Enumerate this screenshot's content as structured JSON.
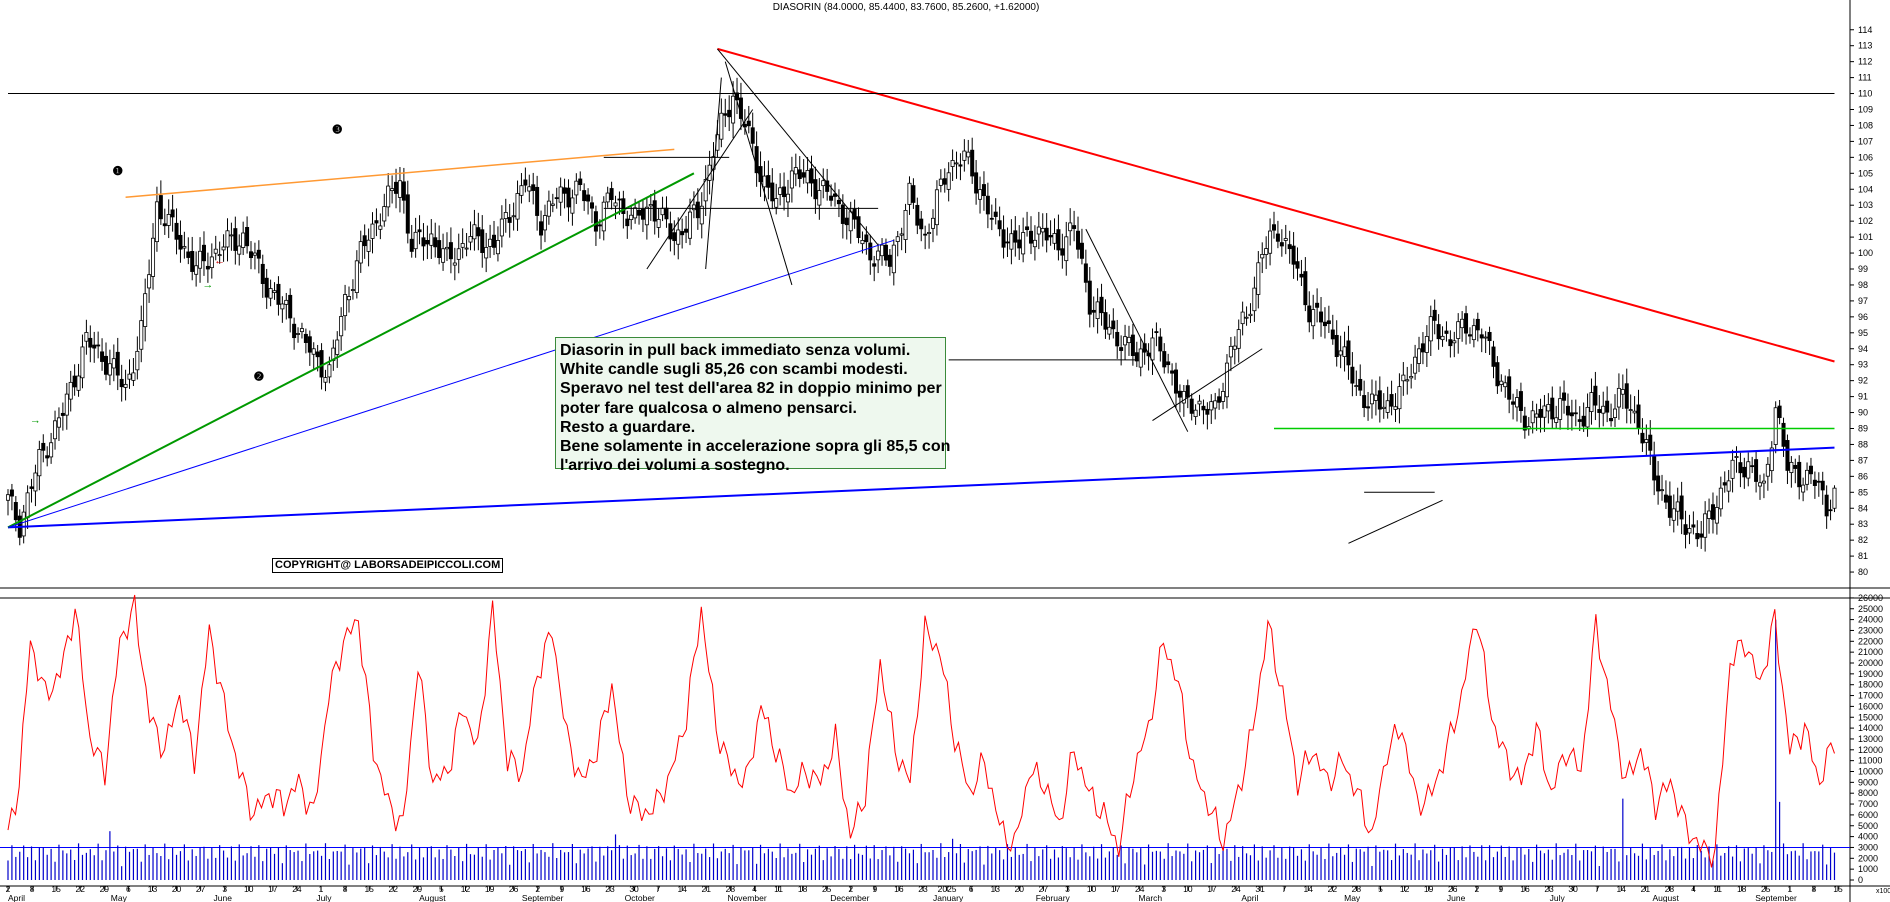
{
  "header": {
    "title": "DIASORIN (84.0000, 85.4400, 83.7600, 85.2600, +1.62000)"
  },
  "annotation": {
    "lines": [
      "Diasorin in pull back immediato senza volumi.",
      "White candle sugli 85,26 con scambi modesti.",
      "Speravo nel test dell'area 82 in doppio minimo per",
      "poter fare qualcosa o almeno pensarci.",
      "Resto a guardare.",
      "Bene solamente in accelerazione sopra gli 85,5 con",
      "l'arrivo dei volumi a sostegno."
    ]
  },
  "copyright": "COPYRIGHT@ LABORSADEIPICCOLI.COM",
  "markers": [
    "❶",
    "❷",
    "❸"
  ],
  "volume_scale_label": "x100",
  "chart_data": [
    {
      "type": "candlestick",
      "title": "DIASORIN (84.0000, 85.4400, 83.7600, 85.2600, +1.62000)",
      "ylim": [
        79,
        115
      ],
      "yticks": [
        80,
        81,
        82,
        83,
        84,
        85,
        86,
        87,
        88,
        89,
        90,
        91,
        92,
        93,
        94,
        95,
        96,
        97,
        98,
        99,
        100,
        101,
        102,
        103,
        104,
        105,
        106,
        107,
        108,
        109,
        110,
        111,
        112,
        113,
        114
      ],
      "x_labels": [
        "2",
        "8",
        "15",
        "22",
        "29",
        "6",
        "13",
        "20",
        "27",
        "3",
        "10",
        "17",
        "24",
        "1",
        "8",
        "15",
        "22",
        "29",
        "5",
        "12",
        "19",
        "26",
        "2",
        "9",
        "16",
        "23",
        "30",
        "7",
        "14",
        "21",
        "28",
        "4",
        "11",
        "18",
        "25",
        "2",
        "9",
        "16",
        "23",
        "2025",
        "6",
        "13",
        "20",
        "27",
        "3",
        "10",
        "17",
        "24",
        "3",
        "10",
        "17",
        "24",
        "31",
        "7",
        "14",
        "22",
        "28",
        "5",
        "12",
        "19",
        "26",
        "2",
        "9",
        "16",
        "23",
        "30",
        "7",
        "14",
        "21",
        "28",
        "4",
        "11",
        "18",
        "25",
        "1",
        "8",
        "15"
      ],
      "month_labels": [
        "April",
        "May",
        "June",
        "July",
        "August",
        "September",
        "October",
        "November",
        "December",
        "January",
        "February",
        "March",
        "April",
        "May",
        "June",
        "July",
        "August",
        "September"
      ],
      "last_candle": {
        "open": 84.0,
        "high": 85.44,
        "low": 83.76,
        "close": 85.26,
        "change": 1.62
      },
      "close_path": [
        [
          0,
          84.5
        ],
        [
          3,
          83.0
        ],
        [
          8,
          87.0
        ],
        [
          14,
          90.0
        ],
        [
          20,
          94.5
        ],
        [
          26,
          93.0
        ],
        [
          30,
          91.5
        ],
        [
          34,
          95.0
        ],
        [
          38,
          103.0
        ],
        [
          42,
          101.5
        ],
        [
          48,
          99.0
        ],
        [
          55,
          100.5
        ],
        [
          60,
          101.0
        ],
        [
          66,
          98.0
        ],
        [
          72,
          96.0
        ],
        [
          78,
          93.5
        ],
        [
          82,
          92.5
        ],
        [
          86,
          97.0
        ],
        [
          90,
          100.0
        ],
        [
          96,
          103.0
        ],
        [
          100,
          104.5
        ],
        [
          103,
          100.5
        ],
        [
          108,
          101.0
        ],
        [
          112,
          99.5
        ],
        [
          118,
          101.0
        ],
        [
          124,
          100.5
        ],
        [
          128,
          102.5
        ],
        [
          132,
          104.5
        ],
        [
          136,
          102.0
        ],
        [
          140,
          103.5
        ],
        [
          146,
          104.0
        ],
        [
          150,
          102.0
        ],
        [
          154,
          103.5
        ],
        [
          160,
          102.0
        ],
        [
          164,
          103.0
        ],
        [
          170,
          101.0
        ],
        [
          176,
          102.5
        ],
        [
          180,
          106.5
        ],
        [
          185,
          110.0
        ],
        [
          188,
          108.0
        ],
        [
          192,
          105.0
        ],
        [
          196,
          103.0
        ],
        [
          200,
          105.0
        ],
        [
          205,
          104.5
        ],
        [
          210,
          103.5
        ],
        [
          215,
          102.0
        ],
        [
          220,
          100.0
        ],
        [
          225,
          99.5
        ],
        [
          230,
          103.5
        ],
        [
          234,
          101.0
        ],
        [
          240,
          105.5
        ],
        [
          244,
          106.0
        ],
        [
          248,
          104.0
        ],
        [
          252,
          101.5
        ],
        [
          258,
          100.5
        ],
        [
          262,
          101.5
        ],
        [
          268,
          100.5
        ],
        [
          272,
          101.5
        ],
        [
          276,
          97.0
        ],
        [
          280,
          95.5
        ],
        [
          284,
          94.5
        ],
        [
          288,
          93.5
        ],
        [
          292,
          94.5
        ],
        [
          296,
          93.0
        ],
        [
          300,
          90.5
        ],
        [
          304,
          90.5
        ],
        [
          308,
          90.0
        ],
        [
          312,
          94.0
        ],
        [
          316,
          96.0
        ],
        [
          320,
          100.0
        ],
        [
          324,
          101.5
        ],
        [
          328,
          99.5
        ],
        [
          332,
          96.5
        ],
        [
          336,
          95.5
        ],
        [
          340,
          94.0
        ],
        [
          344,
          91.5
        ],
        [
          348,
          90.5
        ],
        [
          352,
          90.5
        ],
        [
          356,
          91.5
        ],
        [
          360,
          94.0
        ],
        [
          364,
          95.5
        ],
        [
          368,
          94.5
        ],
        [
          372,
          95.5
        ],
        [
          376,
          95.0
        ],
        [
          380,
          92.5
        ],
        [
          384,
          90.5
        ],
        [
          388,
          89.5
        ],
        [
          392,
          90.0
        ],
        [
          396,
          90.5
        ],
        [
          400,
          89.5
        ],
        [
          404,
          90.5
        ],
        [
          408,
          90.0
        ],
        [
          412,
          91.0
        ],
        [
          416,
          89.5
        ],
        [
          420,
          86.0
        ],
        [
          424,
          84.0
        ],
        [
          428,
          83.0
        ],
        [
          432,
          82.3
        ],
        [
          436,
          84.5
        ],
        [
          440,
          86.5
        ],
        [
          444,
          86.8
        ],
        [
          448,
          85.0
        ],
        [
          451,
          90.5
        ],
        [
          454,
          86.5
        ],
        [
          458,
          86.0
        ],
        [
          462,
          85.5
        ],
        [
          464,
          84.0
        ],
        [
          466,
          85.26
        ]
      ],
      "trendlines": [
        {
          "name": "red_resistance",
          "color": "#ff0000",
          "from": [
            181,
            112.8
          ],
          "to": [
            466,
            93.2
          ]
        },
        {
          "name": "blue_support_long",
          "color": "#0000ff",
          "from": [
            0,
            82.8
          ],
          "to": [
            466,
            87.8
          ]
        },
        {
          "name": "green_support",
          "color": "#009900",
          "from": [
            0,
            82.8
          ],
          "to": [
            175,
            105.0
          ]
        },
        {
          "name": "orange_resistance",
          "color": "#ff9933",
          "from": [
            30,
            103.5
          ],
          "to": [
            170,
            106.5
          ]
        },
        {
          "name": "green_horizontal_89",
          "color": "#00cc00",
          "from": [
            323,
            89.0
          ],
          "to": [
            466,
            89.0
          ]
        },
        {
          "name": "black_horizontal_110",
          "color": "#000000",
          "from": [
            0,
            110.0
          ],
          "to": [
            466,
            110.0
          ]
        }
      ]
    },
    {
      "type": "line",
      "series": [
        {
          "name": "volume_average",
          "color": "#ff0000"
        }
      ],
      "ylim": [
        0,
        26000
      ],
      "yticks": [
        0,
        1000,
        2000,
        3000,
        4000,
        5000,
        6000,
        7000,
        8000,
        9000,
        10000,
        11000,
        12000,
        13000,
        14000,
        15000,
        16000,
        17000,
        18000,
        19000,
        20000,
        21000,
        22000,
        23000,
        24000,
        25000,
        26000
      ],
      "reference_line": 3000,
      "red_line_anchors": [
        [
          0,
          4000
        ],
        [
          3,
          9000
        ],
        [
          6,
          22000
        ],
        [
          10,
          17000
        ],
        [
          14,
          19000
        ],
        [
          18,
          25000
        ],
        [
          22,
          13000
        ],
        [
          26,
          10000
        ],
        [
          30,
          22000
        ],
        [
          34,
          25000
        ],
        [
          38,
          15000
        ],
        [
          42,
          12000
        ],
        [
          46,
          17000
        ],
        [
          50,
          11000
        ],
        [
          54,
          23000
        ],
        [
          58,
          16000
        ],
        [
          62,
          10000
        ],
        [
          66,
          6000
        ],
        [
          70,
          8000
        ],
        [
          74,
          7000
        ],
        [
          78,
          9000
        ],
        [
          82,
          6000
        ],
        [
          86,
          17000
        ],
        [
          90,
          22000
        ],
        [
          94,
          24000
        ],
        [
          98,
          12000
        ],
        [
          102,
          7000
        ],
        [
          106,
          5000
        ],
        [
          110,
          20000
        ],
        [
          114,
          9000
        ],
        [
          118,
          10000
        ],
        [
          122,
          16000
        ],
        [
          126,
          12000
        ],
        [
          130,
          25000
        ],
        [
          134,
          11000
        ],
        [
          138,
          10000
        ],
        [
          142,
          19000
        ],
        [
          146,
          23000
        ],
        [
          150,
          13000
        ],
        [
          154,
          9000
        ],
        [
          158,
          12000
        ],
        [
          162,
          18000
        ],
        [
          166,
          8000
        ],
        [
          170,
          6000
        ],
        [
          174,
          7000
        ],
        [
          178,
          10000
        ],
        [
          182,
          15000
        ],
        [
          186,
          25000
        ],
        [
          190,
          14000
        ],
        [
          194,
          10000
        ],
        [
          198,
          9000
        ],
        [
          202,
          16000
        ],
        [
          206,
          12000
        ],
        [
          210,
          8000
        ],
        [
          214,
          10000
        ],
        [
          218,
          9000
        ],
        [
          222,
          13000
        ],
        [
          226,
          4000
        ],
        [
          230,
          8000
        ],
        [
          234,
          20000
        ],
        [
          238,
          12000
        ],
        [
          242,
          9000
        ],
        [
          246,
          23000
        ],
        [
          250,
          21000
        ],
        [
          254,
          13000
        ],
        [
          258,
          8000
        ],
        [
          262,
          11000
        ],
        [
          266,
          5000
        ],
        [
          270,
          3000
        ],
        [
          274,
          10000
        ],
        [
          278,
          9000
        ],
        [
          282,
          5000
        ],
        [
          286,
          12000
        ],
        [
          290,
          8000
        ],
        [
          294,
          6000
        ],
        [
          298,
          3000
        ],
        [
          302,
          10000
        ],
        [
          306,
          14000
        ],
        [
          310,
          22000
        ],
        [
          314,
          18000
        ],
        [
          318,
          10000
        ],
        [
          322,
          7000
        ],
        [
          326,
          3500
        ],
        [
          330,
          8000
        ],
        [
          334,
          14000
        ],
        [
          338,
          23500
        ],
        [
          342,
          17000
        ],
        [
          346,
          9000
        ],
        [
          350,
          12000
        ],
        [
          354,
          9000
        ],
        [
          358,
          11000
        ],
        [
          362,
          8000
        ],
        [
          366,
          4000
        ],
        [
          370,
          12000
        ],
        [
          374,
          14000
        ],
        [
          378,
          7000
        ],
        [
          382,
          8000
        ],
        [
          386,
          12000
        ],
        [
          390,
          17000
        ],
        [
          394,
          24500
        ],
        [
          398,
          15000
        ],
        [
          402,
          11000
        ],
        [
          406,
          9000
        ],
        [
          410,
          14000
        ],
        [
          414,
          8000
        ],
        [
          418,
          12000
        ],
        [
          422,
          10000
        ],
        [
          426,
          23500
        ],
        [
          430,
          16000
        ],
        [
          434,
          9000
        ],
        [
          438,
          12000
        ],
        [
          442,
          7000
        ],
        [
          446,
          9000
        ],
        [
          450,
          5000
        ],
        [
          454,
          3000
        ],
        [
          458,
          2500
        ],
        [
          462,
          20000
        ],
        [
          466,
          22000
        ],
        [
          470,
          18000
        ],
        [
          474,
          24000
        ],
        [
          478,
          12000
        ],
        [
          482,
          14000
        ],
        [
          486,
          9000
        ],
        [
          490,
          13000
        ]
      ]
    }
  ]
}
